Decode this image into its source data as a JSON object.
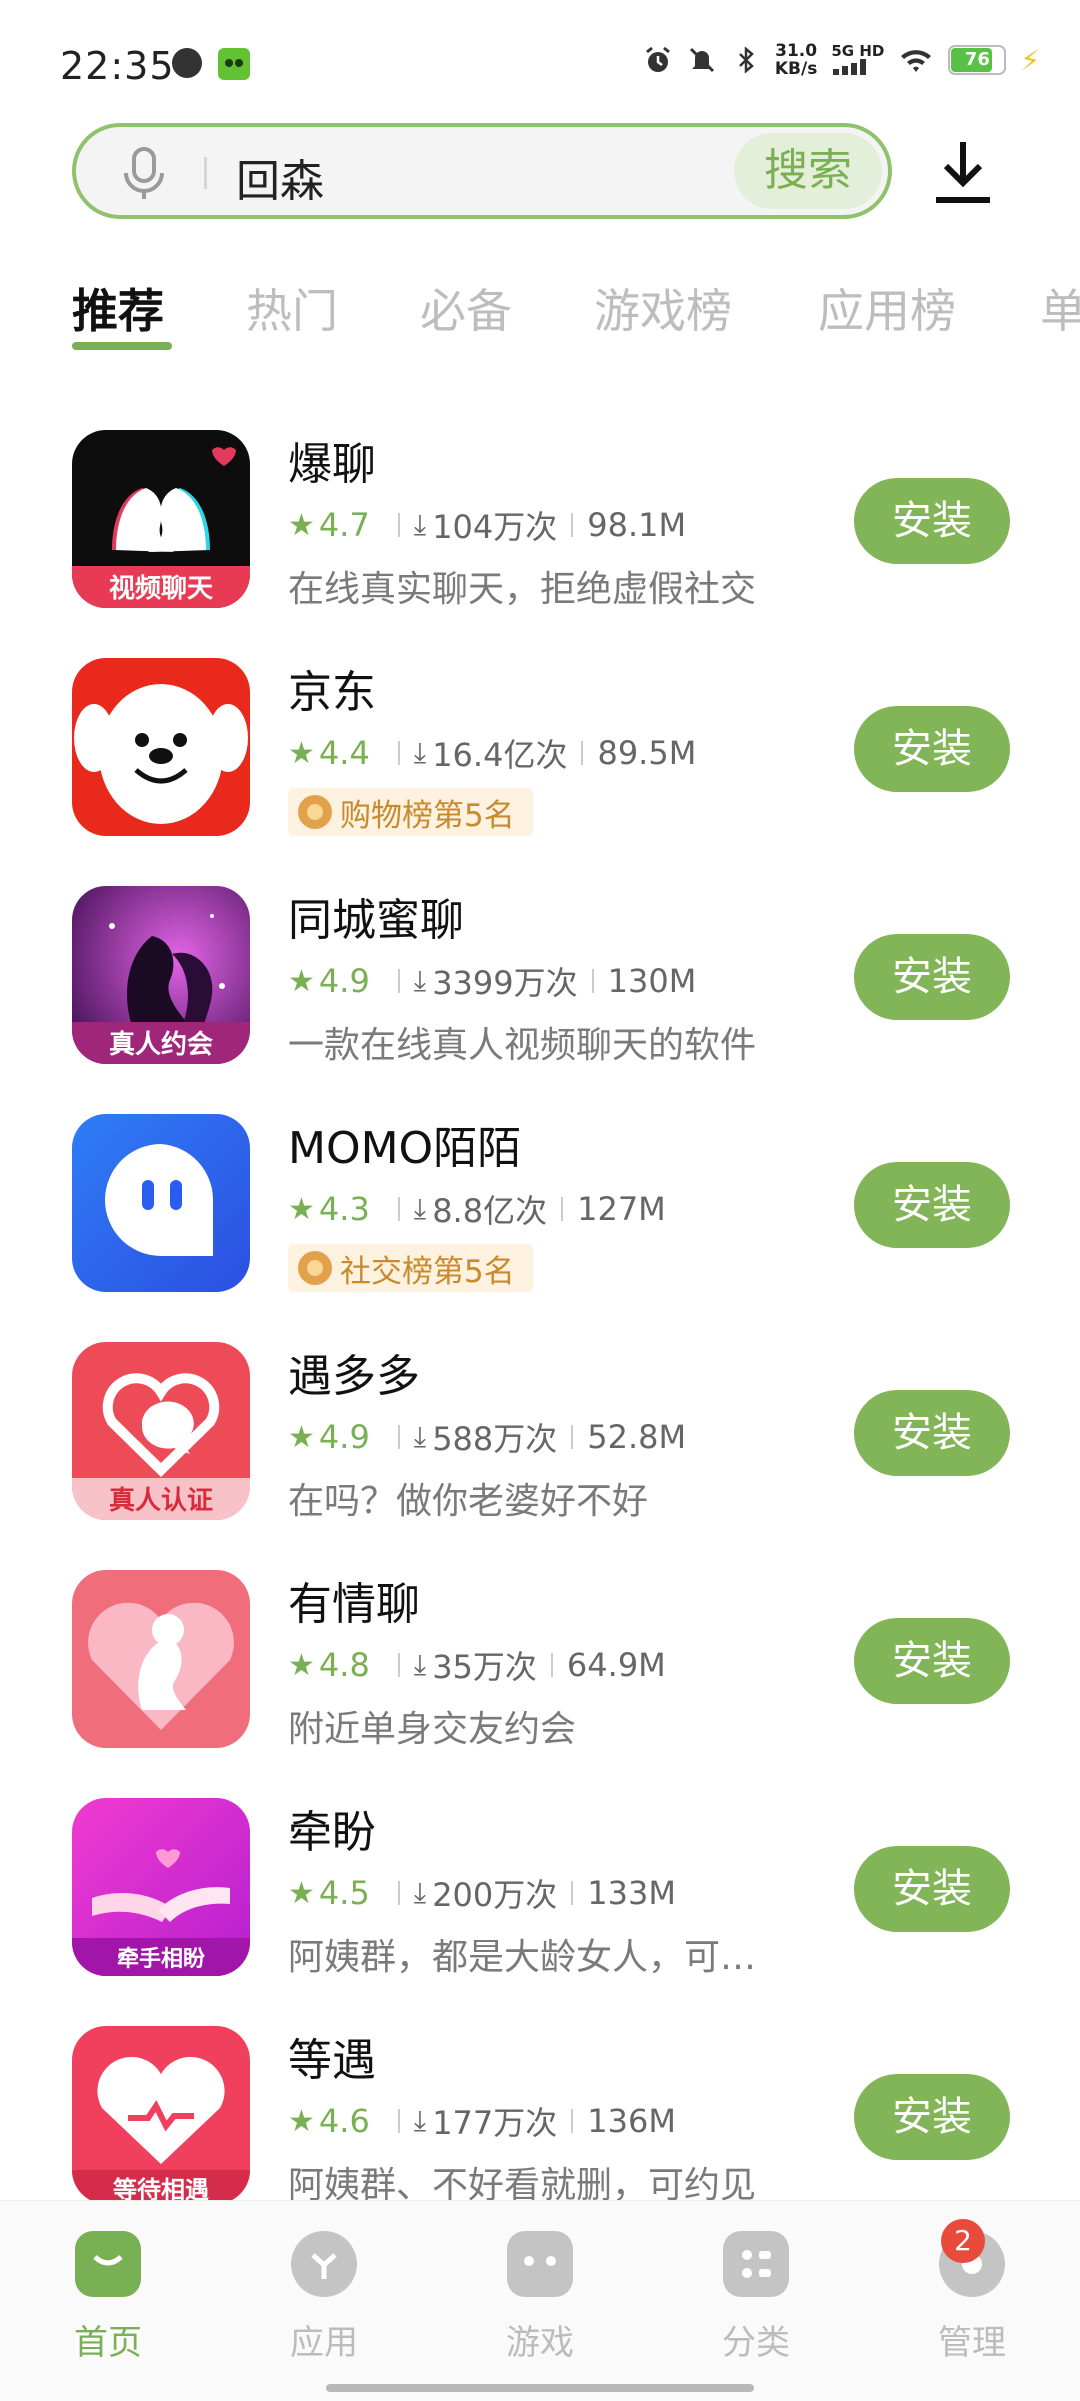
{
  "status_bar": {
    "time": "22:35",
    "net_speed_value": "31.0",
    "net_speed_unit": "KB/s",
    "network_type": "5G HD",
    "battery_level": "76",
    "icons": [
      "nfc-icon",
      "app-notify-icon",
      "alarm-icon",
      "mute-icon",
      "bluetooth-icon",
      "signal-icon",
      "wifi-icon",
      "battery-icon",
      "charging-icon"
    ]
  },
  "search": {
    "query": "回森",
    "button_label": "搜索"
  },
  "tabs": [
    "推荐",
    "热门",
    "必备",
    "游戏榜",
    "应用榜",
    "单"
  ],
  "active_tab_index": 0,
  "apps": [
    {
      "name": "爆聊",
      "rating": "4.7",
      "downloads": "104万次",
      "size": "98.1M",
      "desc": "在线真实聊天，拒绝虚假社交",
      "badge": "",
      "icon_text": "视频聊天",
      "install_label": "安装"
    },
    {
      "name": "京东",
      "rating": "4.4",
      "downloads": "16.4亿次",
      "size": "89.5M",
      "desc": "",
      "badge": "购物榜第5名",
      "icon_text": "",
      "install_label": "安装"
    },
    {
      "name": "同城蜜聊",
      "rating": "4.9",
      "downloads": "3399万次",
      "size": "130M",
      "desc": "一款在线真人视频聊天的软件",
      "badge": "",
      "icon_text": "真人约会",
      "install_label": "安装"
    },
    {
      "name": "MOMO陌陌",
      "rating": "4.3",
      "downloads": "8.8亿次",
      "size": "127M",
      "desc": "",
      "badge": "社交榜第5名",
      "icon_text": "",
      "install_label": "安装"
    },
    {
      "name": "遇多多",
      "rating": "4.9",
      "downloads": "588万次",
      "size": "52.8M",
      "desc": "在吗？做你老婆好不好",
      "badge": "",
      "icon_text": "真人认证",
      "install_label": "安装"
    },
    {
      "name": "有情聊",
      "rating": "4.8",
      "downloads": "35万次",
      "size": "64.9M",
      "desc": "附近单身交友约会",
      "badge": "",
      "icon_text": "",
      "install_label": "安装"
    },
    {
      "name": "牵盼",
      "rating": "4.5",
      "downloads": "200万次",
      "size": "133M",
      "desc": "阿姨群，都是大龄女人，可…",
      "badge": "",
      "icon_text": "牵手相盼",
      "install_label": "安装"
    },
    {
      "name": "等遇",
      "rating": "4.6",
      "downloads": "177万次",
      "size": "136M",
      "desc": "阿姨群、不好看就删，可约见",
      "badge": "",
      "icon_text": "等待相遇",
      "install_label": "安装"
    }
  ],
  "bottom_nav": [
    {
      "label": "首页",
      "icon": "home-bag-icon",
      "active": true
    },
    {
      "label": "应用",
      "icon": "apps-icon",
      "active": false
    },
    {
      "label": "游戏",
      "icon": "gamepad-icon",
      "active": false
    },
    {
      "label": "分类",
      "icon": "category-icon",
      "active": false
    },
    {
      "label": "管理",
      "icon": "manage-icon",
      "active": false,
      "badge": "2"
    }
  ],
  "colors": {
    "accent": "#82b558",
    "accent_text": "#7ab054",
    "badge_bg": "#fdf1df",
    "badge_text": "#c98a2e",
    "notify_red": "#e84a3b"
  }
}
